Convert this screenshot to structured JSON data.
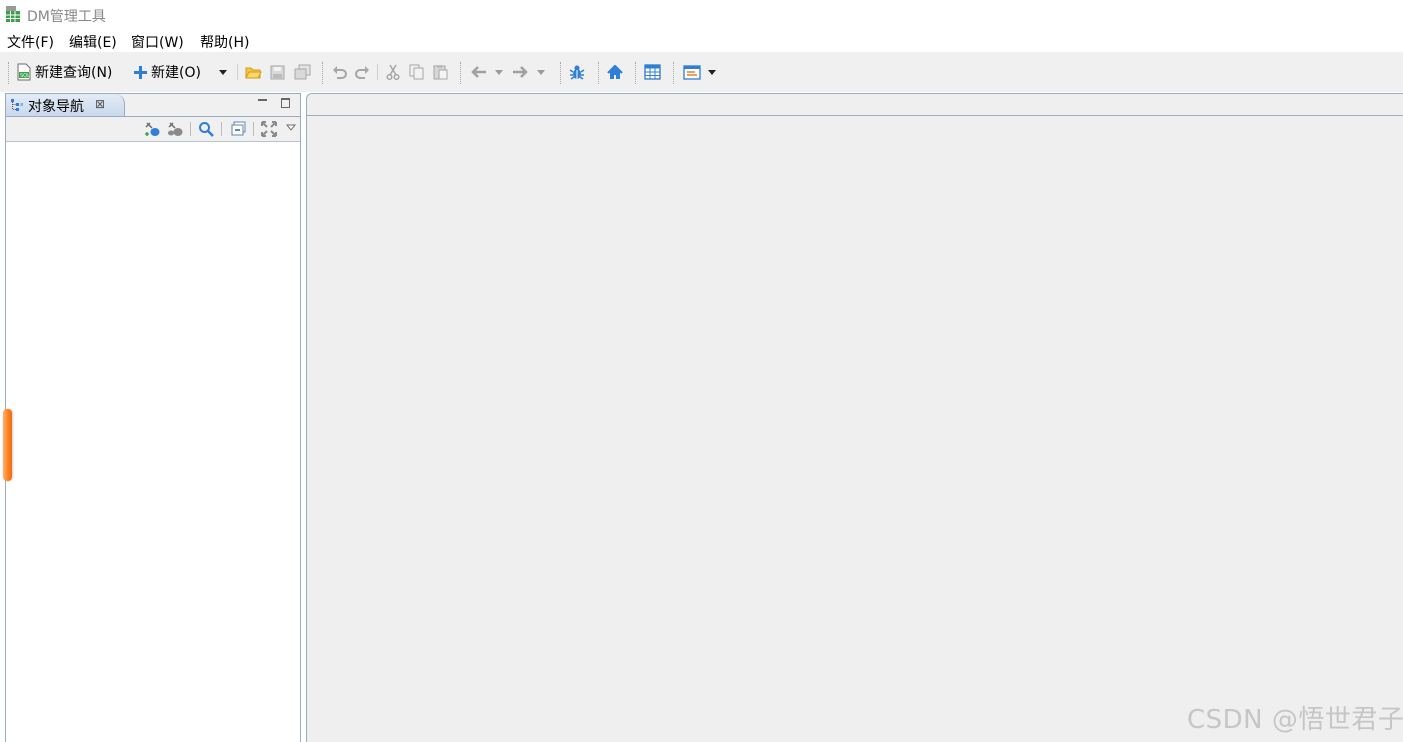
{
  "window": {
    "title": "DM管理工具",
    "icon": "database-table-icon"
  },
  "menubar": {
    "items": [
      {
        "label": "文件(F)"
      },
      {
        "label": "编辑(E)"
      },
      {
        "label": "窗口(W)"
      },
      {
        "label": "帮助(H)"
      }
    ]
  },
  "toolbar": {
    "new_query_label": "新建查询(N)",
    "new_label": "新建(O)",
    "icons": [
      "sql-file-icon",
      "plus-icon",
      "chevron-down-icon",
      "open-folder-icon",
      "save-icon",
      "save-all-icon",
      "undo-icon",
      "redo-icon",
      "cut-icon",
      "copy-icon",
      "paste-icon",
      "back-arrow-icon",
      "forward-arrow-icon",
      "debug-bug-icon",
      "home-icon",
      "table-icon",
      "window-layout-icon"
    ]
  },
  "navigator": {
    "tab_label": "对象导航",
    "close_glyph": "⊠",
    "tools": [
      "new-connection-icon",
      "disconnect-icon",
      "search-icon",
      "collapse-all-icon",
      "expand-icon",
      "view-menu-icon"
    ]
  },
  "colors": {
    "accent_blue": "#2f7ed8",
    "handle_orange": "#ff7d1c",
    "panel_border": "#99acc2",
    "background": "#efefef"
  },
  "watermark": "CSDN @悟世君子"
}
